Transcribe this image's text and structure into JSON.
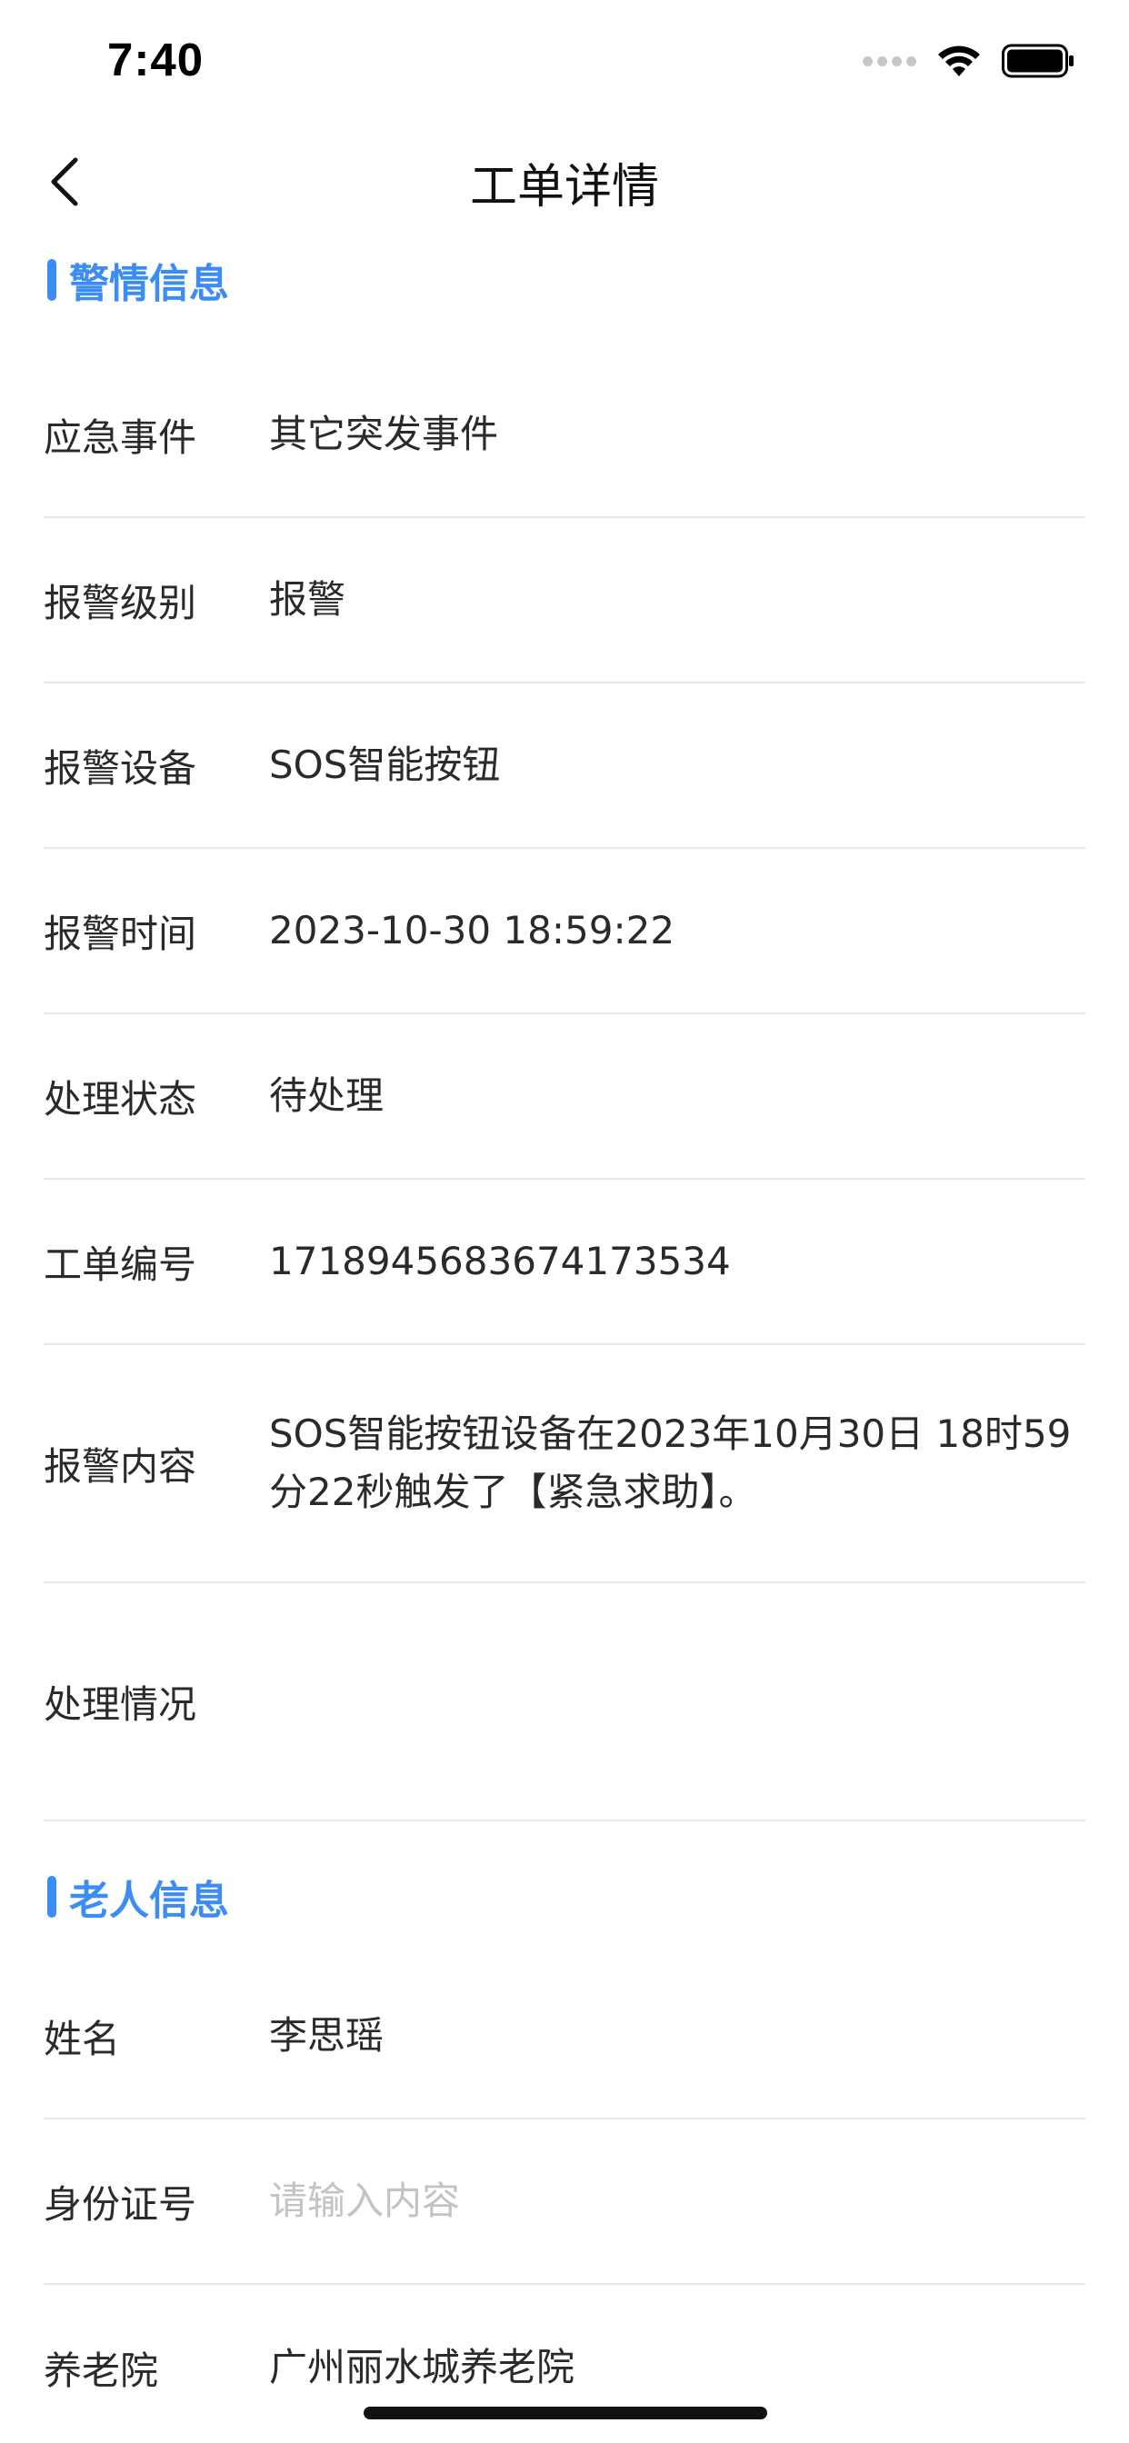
{
  "status_bar": {
    "time": "7:40"
  },
  "nav": {
    "title": "工单详情"
  },
  "alarm_section": {
    "title": "警情信息",
    "rows": [
      {
        "label": "应急事件",
        "value": "其它突发事件"
      },
      {
        "label": "报警级别",
        "value": "报警"
      },
      {
        "label": "报警设备",
        "value": "SOS智能按钮"
      },
      {
        "label": "报警时间",
        "value": "2023-10-30 18:59:22"
      },
      {
        "label": "处理状态",
        "value": "待处理"
      },
      {
        "label": "工单编号",
        "value": "1718945683674173534"
      },
      {
        "label": "报警内容",
        "value": "SOS智能按钮设备在2023年10月30日 18时59分22秒触发了【紧急求助】。"
      },
      {
        "label": "处理情况",
        "value": ""
      }
    ]
  },
  "elder_section": {
    "title": "老人信息",
    "rows": [
      {
        "label": "姓名",
        "value": "李思瑶"
      },
      {
        "label": "身份证号",
        "placeholder": "请输入内容"
      },
      {
        "label": "养老院",
        "value": "广州丽水城养老院"
      }
    ]
  },
  "colors": {
    "accent": "#3b8cf5",
    "divider": "#e8e8e8",
    "placeholder": "#c3c3c3"
  }
}
